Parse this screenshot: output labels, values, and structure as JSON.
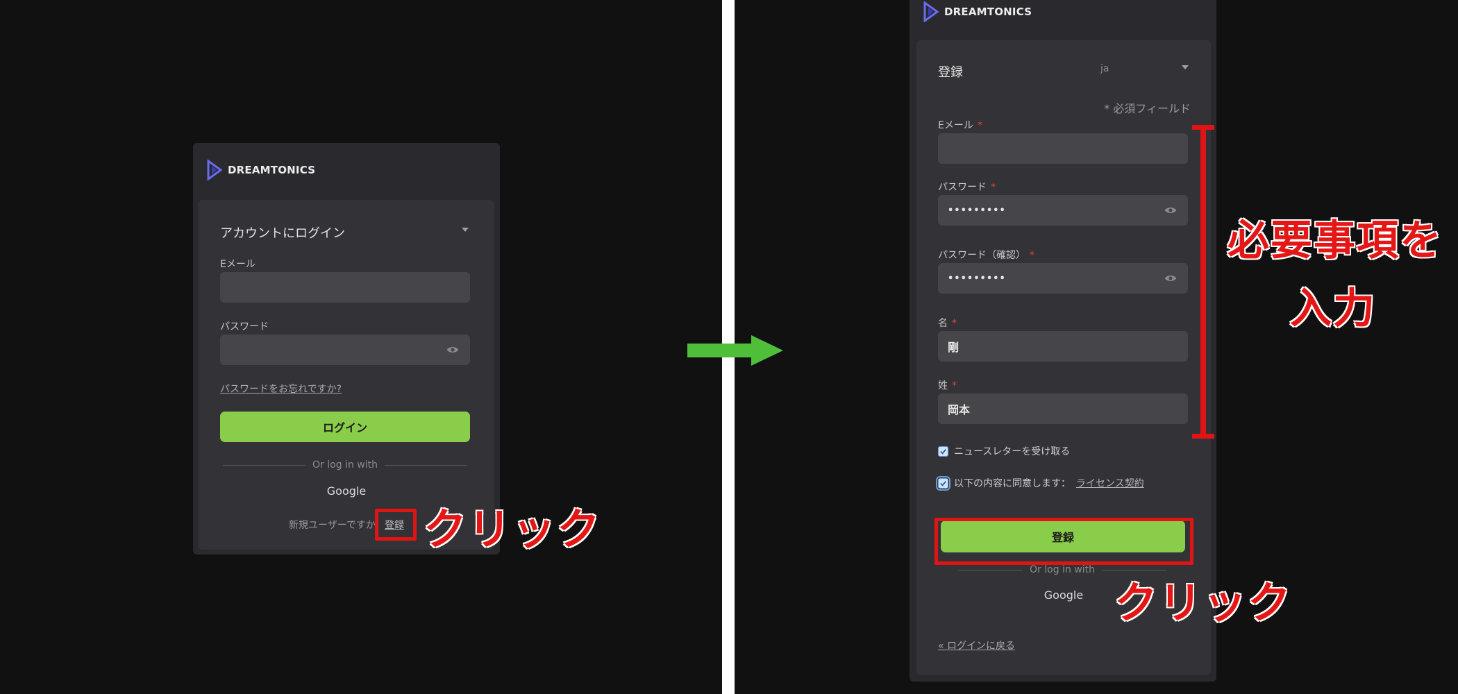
{
  "brand": {
    "name": "DREAMTONICS"
  },
  "login": {
    "title": "アカウントにログイン",
    "email_label": "Eメール",
    "email_value": "",
    "password_label": "パスワード",
    "password_value": "",
    "forgot_link": "パスワードをお忘れですか?",
    "login_button": "ログイン",
    "or_text": "Or log in with",
    "google": "Google",
    "new_user_text": "新規ユーザーですか",
    "register_link": "登録"
  },
  "annotations": {
    "click_left": "クリック",
    "click_right": "クリック",
    "fill_line1": "必要事項を",
    "fill_line2": "入力"
  },
  "register": {
    "title": "登録",
    "language": "ja",
    "required_note": "* 必須フィールド",
    "required_mark": "*",
    "email_label": "Eメール",
    "email_value": "",
    "password_label": "パスワード",
    "password_value": "•••••••••",
    "confirm_label": "パスワード（確認）",
    "confirm_value": "•••••••••",
    "first_name_label": "名",
    "first_name_value": "剛",
    "last_name_label": "姓",
    "last_name_value": "岡本",
    "newsletter_label": "ニュースレターを受け取る",
    "agree_label": "以下の内容に同意します：",
    "license_link": "ライセンス契約",
    "register_button": "登録",
    "or_text": "Or log in with",
    "google": "Google",
    "back_link": "« ログインに戻る"
  },
  "colors": {
    "accent_green": "#8acd4a",
    "annotation_red": "#e41616",
    "arrow_green": "#4fbf3a"
  }
}
